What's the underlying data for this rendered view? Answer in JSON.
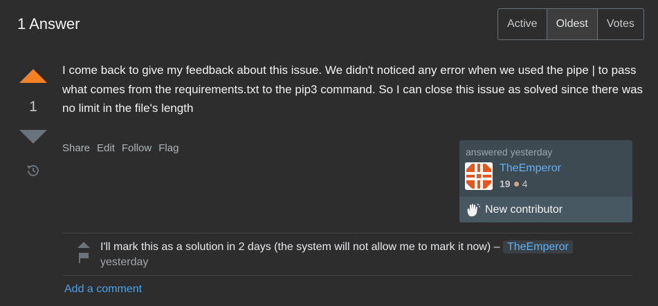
{
  "header": {
    "title": "1 Answer"
  },
  "sort": {
    "options": [
      "Active",
      "Oldest",
      "Votes"
    ],
    "selected": "Oldest"
  },
  "vote": {
    "count": "1"
  },
  "answer": {
    "body": "I come back to give my feedback about this issue. We didn't noticed any error when we used the pipe | to pass what comes from the requirements.txt to the pip3 command. So I can close this issue as solved since there was no limit in the file's length"
  },
  "post_menu": {
    "share": "Share",
    "edit": "Edit",
    "follow": "Follow",
    "flag": "Flag"
  },
  "user_card": {
    "action": "answered yesterday",
    "name": "TheEmperor",
    "reputation": "19",
    "bronze": "4",
    "bronze_color": "#d1a684",
    "contributor_label": "New contributor"
  },
  "comment": {
    "text": "I'll mark this as a solution in 2 days (the system will not allow me to mark it now) –",
    "user": "TheEmperor",
    "date": "yesterday"
  },
  "add_comment": "Add a comment",
  "colors": {
    "background": "#2d2d2d",
    "accent": "#f48225",
    "link": "#5eb1f5"
  }
}
